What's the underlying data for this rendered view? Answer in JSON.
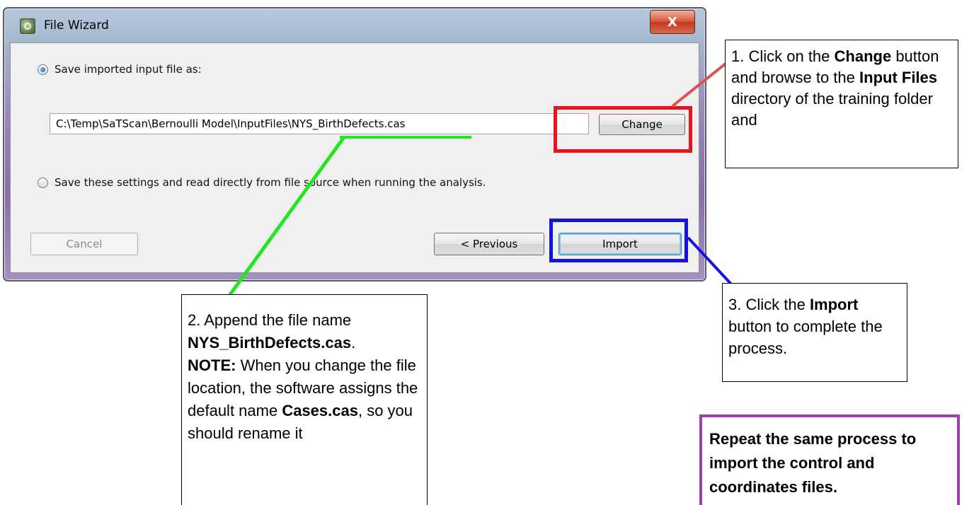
{
  "dialog": {
    "title": "File Wizard",
    "close_label": "X",
    "option_save": "Save imported input file as:",
    "file_path": "C:\\Temp\\SaTScan\\Bernoulli Model\\InputFiles\\NYS_BirthDefects.cas",
    "option_direct": "Save these settings and read directly from file source when running the analysis.",
    "change_label": "Change",
    "cancel_label": "Cancel",
    "previous_label": "< Previous",
    "import_label": "Import"
  },
  "callouts": {
    "step1": {
      "p1": "1. Click on the ",
      "b1": "Change",
      "p2": " button and browse to the ",
      "b2": "Input Files",
      "p3": " directory of the training folder and"
    },
    "step2": {
      "p1": "2. Append the file name ",
      "b1": "NYS_BirthDefects.cas",
      "p2": ".",
      "b2": "NOTE:",
      "p3": " When you change the file location, the software assigns the default name ",
      "b3": "Cases.cas",
      "p4": ", so you should rename it"
    },
    "step3": {
      "p1": "3. Click the ",
      "b1": "Import",
      "p2": " button to complete the process."
    },
    "repeat": "Repeat the same process to import the control and coordinates files."
  },
  "colors": {
    "change_highlight": "#e8141c",
    "import_highlight": "#1414e0",
    "path_leader": "#22e622",
    "change_leader": "#e05050",
    "repeat_border": "#a040b0"
  }
}
